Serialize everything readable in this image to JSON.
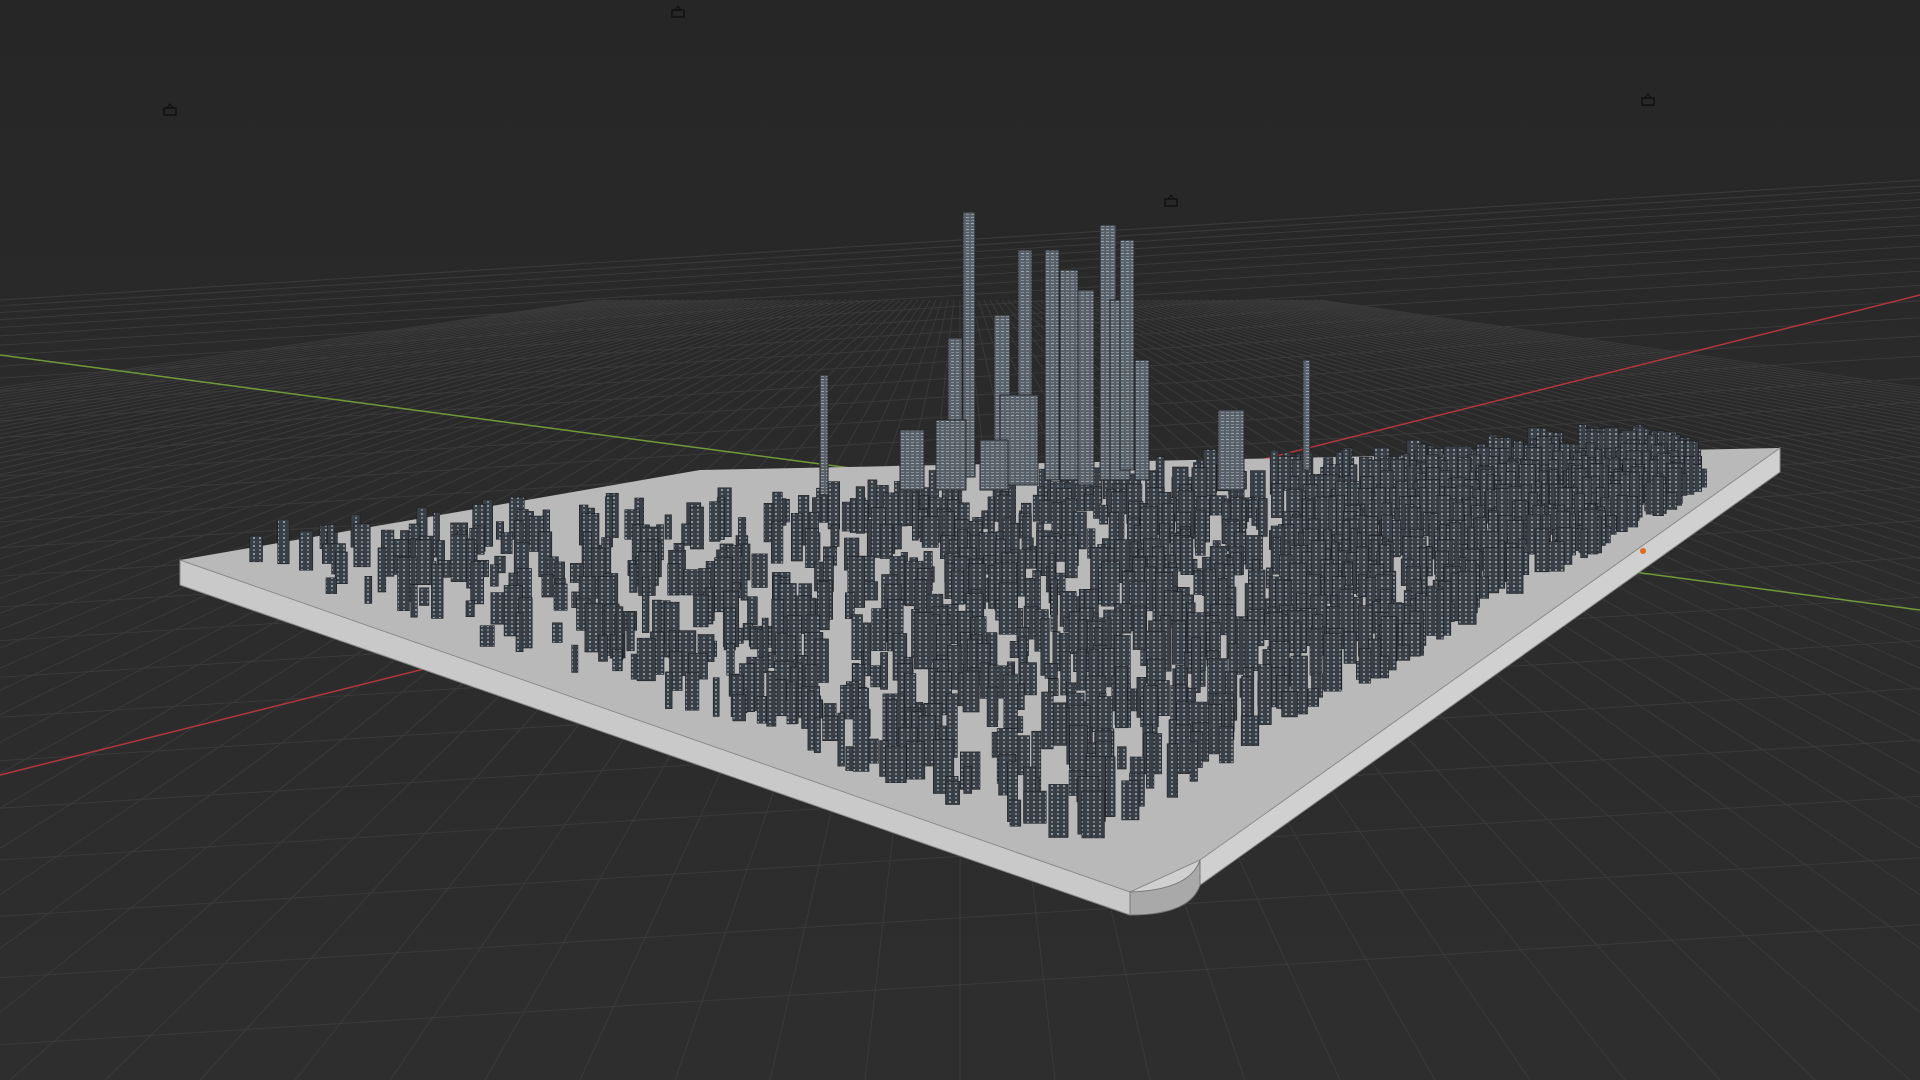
{
  "viewport": {
    "mode": "3d-viewport-solid-wireframe",
    "background_color": "#2b2b2b",
    "grid_color": "#3a3a3a",
    "x_axis_color": "#b5363b",
    "y_axis_color": "#6f9a3a"
  },
  "scene": {
    "objects": [
      {
        "name": "city-base-plate",
        "color": "#c8c8c8"
      },
      {
        "name": "city-buildings",
        "color": "#3b4046"
      },
      {
        "name": "skyscraper-cluster",
        "color": "#6d737b"
      }
    ],
    "camera_icons": [
      "camera-icon",
      "camera-icon",
      "camera-icon",
      "camera-icon"
    ],
    "origin_marker_color": "#e06a1c"
  }
}
